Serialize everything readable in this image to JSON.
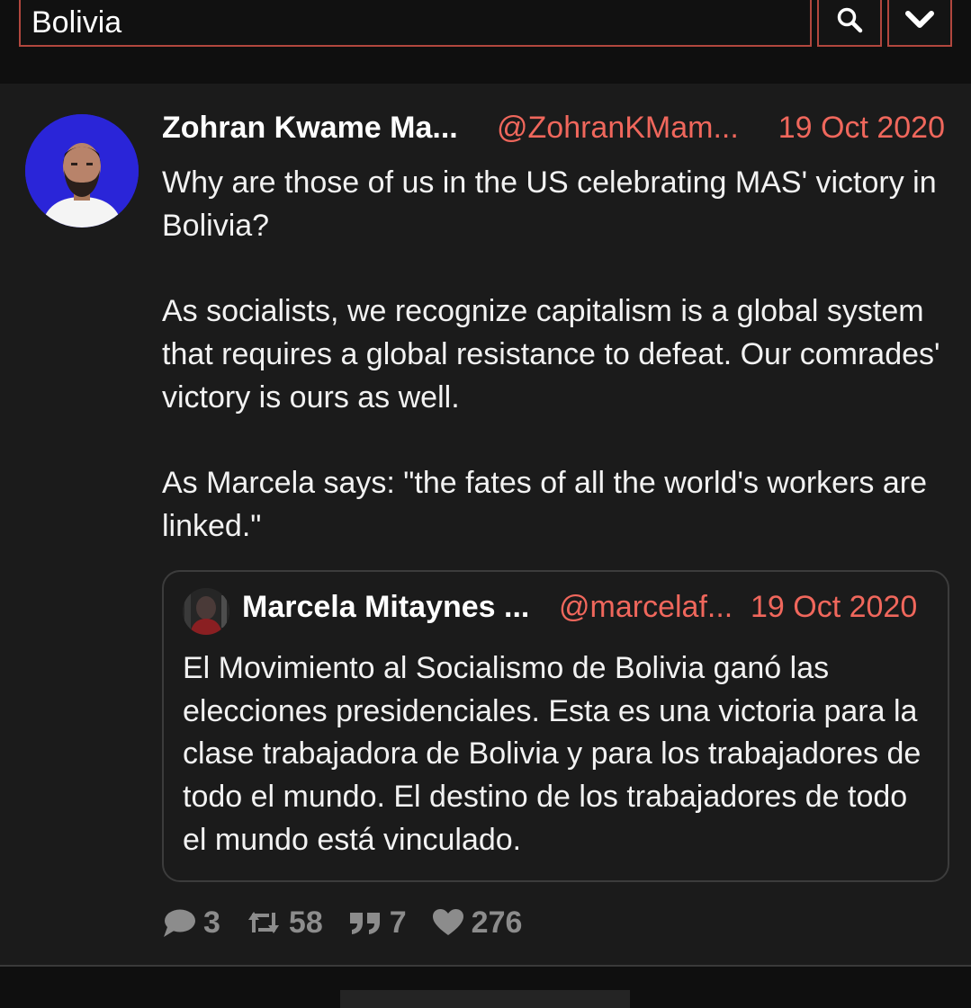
{
  "search": {
    "value": "Bolivia"
  },
  "tweet": {
    "author_name": "Zohran Kwame Ma...",
    "author_handle": "@ZohranKMam...",
    "date": "19 Oct 2020",
    "paragraphs": [
      "Why are those of us in the US celebrating MAS' victory in Bolivia?",
      "As socialists, we recognize capitalism is a global system that requires a global resistance to defeat. Our comrades' victory is ours as well.",
      "As Marcela says: \"the fates of all the world's workers are linked.\""
    ],
    "quote": {
      "author_name": "Marcela Mitaynes ...",
      "author_handle": "@marcelaf...",
      "date": "19 Oct 2020",
      "text": "El Movimiento al Socialismo de Bolivia ganó las elecciones presidenciales.  Esta es una victoria para la clase trabajadora de Bolivia y para los trabajadores de todo el mundo.  El destino de los trabajadores de todo el mundo está vinculado."
    },
    "stats": {
      "replies": "3",
      "retweets": "58",
      "quotes": "7",
      "likes": "276"
    }
  },
  "colors": {
    "accent": "#f0675c",
    "border_accent": "#b2473e",
    "card_bg": "#1b1b1b",
    "page_bg": "#0f0f0f"
  },
  "icons": [
    "search-icon",
    "chevron-down-icon",
    "reply-icon",
    "retweet-icon",
    "quote-icon",
    "heart-icon"
  ]
}
